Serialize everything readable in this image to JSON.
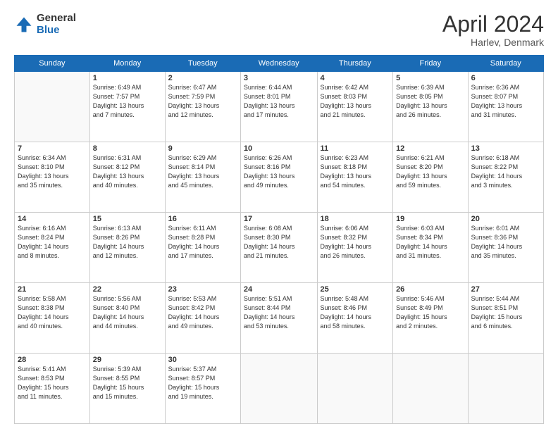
{
  "logo": {
    "general": "General",
    "blue": "Blue"
  },
  "header": {
    "month": "April 2024",
    "location": "Harlev, Denmark"
  },
  "weekdays": [
    "Sunday",
    "Monday",
    "Tuesday",
    "Wednesday",
    "Thursday",
    "Friday",
    "Saturday"
  ],
  "weeks": [
    [
      {
        "day": "",
        "info": ""
      },
      {
        "day": "1",
        "info": "Sunrise: 6:49 AM\nSunset: 7:57 PM\nDaylight: 13 hours\nand 7 minutes."
      },
      {
        "day": "2",
        "info": "Sunrise: 6:47 AM\nSunset: 7:59 PM\nDaylight: 13 hours\nand 12 minutes."
      },
      {
        "day": "3",
        "info": "Sunrise: 6:44 AM\nSunset: 8:01 PM\nDaylight: 13 hours\nand 17 minutes."
      },
      {
        "day": "4",
        "info": "Sunrise: 6:42 AM\nSunset: 8:03 PM\nDaylight: 13 hours\nand 21 minutes."
      },
      {
        "day": "5",
        "info": "Sunrise: 6:39 AM\nSunset: 8:05 PM\nDaylight: 13 hours\nand 26 minutes."
      },
      {
        "day": "6",
        "info": "Sunrise: 6:36 AM\nSunset: 8:07 PM\nDaylight: 13 hours\nand 31 minutes."
      }
    ],
    [
      {
        "day": "7",
        "info": "Sunrise: 6:34 AM\nSunset: 8:10 PM\nDaylight: 13 hours\nand 35 minutes."
      },
      {
        "day": "8",
        "info": "Sunrise: 6:31 AM\nSunset: 8:12 PM\nDaylight: 13 hours\nand 40 minutes."
      },
      {
        "day": "9",
        "info": "Sunrise: 6:29 AM\nSunset: 8:14 PM\nDaylight: 13 hours\nand 45 minutes."
      },
      {
        "day": "10",
        "info": "Sunrise: 6:26 AM\nSunset: 8:16 PM\nDaylight: 13 hours\nand 49 minutes."
      },
      {
        "day": "11",
        "info": "Sunrise: 6:23 AM\nSunset: 8:18 PM\nDaylight: 13 hours\nand 54 minutes."
      },
      {
        "day": "12",
        "info": "Sunrise: 6:21 AM\nSunset: 8:20 PM\nDaylight: 13 hours\nand 59 minutes."
      },
      {
        "day": "13",
        "info": "Sunrise: 6:18 AM\nSunset: 8:22 PM\nDaylight: 14 hours\nand 3 minutes."
      }
    ],
    [
      {
        "day": "14",
        "info": "Sunrise: 6:16 AM\nSunset: 8:24 PM\nDaylight: 14 hours\nand 8 minutes."
      },
      {
        "day": "15",
        "info": "Sunrise: 6:13 AM\nSunset: 8:26 PM\nDaylight: 14 hours\nand 12 minutes."
      },
      {
        "day": "16",
        "info": "Sunrise: 6:11 AM\nSunset: 8:28 PM\nDaylight: 14 hours\nand 17 minutes."
      },
      {
        "day": "17",
        "info": "Sunrise: 6:08 AM\nSunset: 8:30 PM\nDaylight: 14 hours\nand 21 minutes."
      },
      {
        "day": "18",
        "info": "Sunrise: 6:06 AM\nSunset: 8:32 PM\nDaylight: 14 hours\nand 26 minutes."
      },
      {
        "day": "19",
        "info": "Sunrise: 6:03 AM\nSunset: 8:34 PM\nDaylight: 14 hours\nand 31 minutes."
      },
      {
        "day": "20",
        "info": "Sunrise: 6:01 AM\nSunset: 8:36 PM\nDaylight: 14 hours\nand 35 minutes."
      }
    ],
    [
      {
        "day": "21",
        "info": "Sunrise: 5:58 AM\nSunset: 8:38 PM\nDaylight: 14 hours\nand 40 minutes."
      },
      {
        "day": "22",
        "info": "Sunrise: 5:56 AM\nSunset: 8:40 PM\nDaylight: 14 hours\nand 44 minutes."
      },
      {
        "day": "23",
        "info": "Sunrise: 5:53 AM\nSunset: 8:42 PM\nDaylight: 14 hours\nand 49 minutes."
      },
      {
        "day": "24",
        "info": "Sunrise: 5:51 AM\nSunset: 8:44 PM\nDaylight: 14 hours\nand 53 minutes."
      },
      {
        "day": "25",
        "info": "Sunrise: 5:48 AM\nSunset: 8:46 PM\nDaylight: 14 hours\nand 58 minutes."
      },
      {
        "day": "26",
        "info": "Sunrise: 5:46 AM\nSunset: 8:49 PM\nDaylight: 15 hours\nand 2 minutes."
      },
      {
        "day": "27",
        "info": "Sunrise: 5:44 AM\nSunset: 8:51 PM\nDaylight: 15 hours\nand 6 minutes."
      }
    ],
    [
      {
        "day": "28",
        "info": "Sunrise: 5:41 AM\nSunset: 8:53 PM\nDaylight: 15 hours\nand 11 minutes."
      },
      {
        "day": "29",
        "info": "Sunrise: 5:39 AM\nSunset: 8:55 PM\nDaylight: 15 hours\nand 15 minutes."
      },
      {
        "day": "30",
        "info": "Sunrise: 5:37 AM\nSunset: 8:57 PM\nDaylight: 15 hours\nand 19 minutes."
      },
      {
        "day": "",
        "info": ""
      },
      {
        "day": "",
        "info": ""
      },
      {
        "day": "",
        "info": ""
      },
      {
        "day": "",
        "info": ""
      }
    ]
  ]
}
